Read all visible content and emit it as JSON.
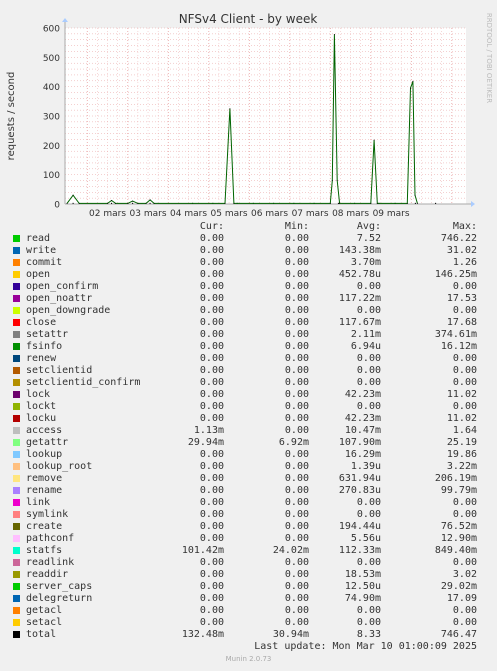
{
  "chart_data": {
    "type": "line",
    "title": "NFSv4 Client - by week",
    "ylabel": "requests / second",
    "ylim": [
      0,
      600
    ],
    "y_ticks": [
      "0",
      "100",
      "200",
      "300",
      "400",
      "500",
      "600"
    ],
    "x_ticks": [
      "02 mars",
      "03 mars",
      "04 mars",
      "05 mars",
      "06 mars",
      "07 mars",
      "08 mars",
      "09 mars"
    ],
    "grid": true,
    "side_label": "RRDTOOL / TOBI OETIKER",
    "series": [
      {
        "name": "total",
        "points": [
          [
            0.5,
            2
          ],
          [
            0.65,
            30
          ],
          [
            0.8,
            2
          ],
          [
            1.5,
            2
          ],
          [
            1.6,
            12
          ],
          [
            1.7,
            2
          ],
          [
            2.0,
            2
          ],
          [
            2.12,
            10
          ],
          [
            2.25,
            2
          ],
          [
            2.45,
            2
          ],
          [
            2.55,
            14
          ],
          [
            2.65,
            2
          ],
          [
            4.4,
            2
          ],
          [
            4.52,
            325
          ],
          [
            4.62,
            2
          ],
          [
            7.0,
            2
          ],
          [
            7.05,
            80
          ],
          [
            7.1,
            578
          ],
          [
            7.17,
            80
          ],
          [
            7.23,
            2
          ],
          [
            8.0,
            2
          ],
          [
            8.08,
            218
          ],
          [
            8.16,
            2
          ],
          [
            8.9,
            2
          ],
          [
            8.98,
            395
          ],
          [
            9.04,
            418
          ],
          [
            9.09,
            30
          ],
          [
            9.15,
            2
          ]
        ]
      }
    ],
    "small_spikes_x": [
      0.65,
      1.6,
      2.12,
      2.55,
      3.6,
      4.1,
      4.7,
      5.1,
      5.6,
      6.1,
      6.6,
      7.2,
      7.6,
      8.2,
      8.6,
      9.1,
      9.6
    ],
    "colors": {
      "line": "#006400",
      "grid": "#e8a0a0",
      "axis": "#aaaaaa",
      "background": "#ffffff"
    }
  },
  "legend": {
    "headers": {
      "cur": "Cur:",
      "min": "Min:",
      "avg": "Avg:",
      "max": "Max:"
    },
    "rows": [
      {
        "name": "read",
        "color": "#00cc00",
        "cur": "0.00",
        "min": "0.00",
        "avg": "7.52",
        "max": "746.22"
      },
      {
        "name": "write",
        "color": "#0066b3",
        "cur": "0.00",
        "min": "0.00",
        "avg": "143.38m",
        "max": "31.02"
      },
      {
        "name": "commit",
        "color": "#ff8000",
        "cur": "0.00",
        "min": "0.00",
        "avg": "3.70m",
        "max": "1.26"
      },
      {
        "name": "open",
        "color": "#ffcc00",
        "cur": "0.00",
        "min": "0.00",
        "avg": "452.78u",
        "max": "146.25m"
      },
      {
        "name": "open_confirm",
        "color": "#330099",
        "cur": "0.00",
        "min": "0.00",
        "avg": "0.00",
        "max": "0.00"
      },
      {
        "name": "open_noattr",
        "color": "#990099",
        "cur": "0.00",
        "min": "0.00",
        "avg": "117.22m",
        "max": "17.53"
      },
      {
        "name": "open_downgrade",
        "color": "#ccff00",
        "cur": "0.00",
        "min": "0.00",
        "avg": "0.00",
        "max": "0.00"
      },
      {
        "name": "close",
        "color": "#ff0000",
        "cur": "0.00",
        "min": "0.00",
        "avg": "117.67m",
        "max": "17.68"
      },
      {
        "name": "setattr",
        "color": "#808080",
        "cur": "0.00",
        "min": "0.00",
        "avg": "2.11m",
        "max": "374.61m"
      },
      {
        "name": "fsinfo",
        "color": "#008f00",
        "cur": "0.00",
        "min": "0.00",
        "avg": "6.94u",
        "max": "16.12m"
      },
      {
        "name": "renew",
        "color": "#00487d",
        "cur": "0.00",
        "min": "0.00",
        "avg": "0.00",
        "max": "0.00"
      },
      {
        "name": "setclientid",
        "color": "#b35a00",
        "cur": "0.00",
        "min": "0.00",
        "avg": "0.00",
        "max": "0.00"
      },
      {
        "name": "setclientid_confirm",
        "color": "#b38f00",
        "cur": "0.00",
        "min": "0.00",
        "avg": "0.00",
        "max": "0.00"
      },
      {
        "name": "lock",
        "color": "#6b006b",
        "cur": "0.00",
        "min": "0.00",
        "avg": "42.23m",
        "max": "11.02"
      },
      {
        "name": "lockt",
        "color": "#8fb300",
        "cur": "0.00",
        "min": "0.00",
        "avg": "0.00",
        "max": "0.00"
      },
      {
        "name": "locku",
        "color": "#b30000",
        "cur": "0.00",
        "min": "0.00",
        "avg": "42.23m",
        "max": "11.02"
      },
      {
        "name": "access",
        "color": "#bebebe",
        "cur": "1.13m",
        "min": "0.00",
        "avg": "10.47m",
        "max": "1.64"
      },
      {
        "name": "getattr",
        "color": "#80ff80",
        "cur": "29.94m",
        "min": "6.92m",
        "avg": "107.90m",
        "max": "25.19"
      },
      {
        "name": "lookup",
        "color": "#80c9ff",
        "cur": "0.00",
        "min": "0.00",
        "avg": "16.29m",
        "max": "19.86"
      },
      {
        "name": "lookup_root",
        "color": "#ffc080",
        "cur": "0.00",
        "min": "0.00",
        "avg": "1.39u",
        "max": "3.22m"
      },
      {
        "name": "remove",
        "color": "#ffe680",
        "cur": "0.00",
        "min": "0.00",
        "avg": "631.94u",
        "max": "206.19m"
      },
      {
        "name": "rename",
        "color": "#aa80ff",
        "cur": "0.00",
        "min": "0.00",
        "avg": "270.83u",
        "max": "99.79m"
      },
      {
        "name": "link",
        "color": "#ee00cc",
        "cur": "0.00",
        "min": "0.00",
        "avg": "0.00",
        "max": "0.00"
      },
      {
        "name": "symlink",
        "color": "#ff8080",
        "cur": "0.00",
        "min": "0.00",
        "avg": "0.00",
        "max": "0.00"
      },
      {
        "name": "create",
        "color": "#666600",
        "cur": "0.00",
        "min": "0.00",
        "avg": "194.44u",
        "max": "76.52m"
      },
      {
        "name": "pathconf",
        "color": "#ffbfff",
        "cur": "0.00",
        "min": "0.00",
        "avg": "5.56u",
        "max": "12.90m"
      },
      {
        "name": "statfs",
        "color": "#00ffcc",
        "cur": "101.42m",
        "min": "24.02m",
        "avg": "112.33m",
        "max": "849.40m"
      },
      {
        "name": "readlink",
        "color": "#cc6699",
        "cur": "0.00",
        "min": "0.00",
        "avg": "0.00",
        "max": "0.00"
      },
      {
        "name": "readdir",
        "color": "#999900",
        "cur": "0.00",
        "min": "0.00",
        "avg": "18.53m",
        "max": "3.02"
      },
      {
        "name": "server_caps",
        "color": "#00cc00",
        "cur": "0.00",
        "min": "0.00",
        "avg": "12.50u",
        "max": "29.02m"
      },
      {
        "name": "delegreturn",
        "color": "#0066b3",
        "cur": "0.00",
        "min": "0.00",
        "avg": "74.90m",
        "max": "17.09"
      },
      {
        "name": "getacl",
        "color": "#ff8000",
        "cur": "0.00",
        "min": "0.00",
        "avg": "0.00",
        "max": "0.00"
      },
      {
        "name": "setacl",
        "color": "#ffcc00",
        "cur": "0.00",
        "min": "0.00",
        "avg": "0.00",
        "max": "0.00"
      },
      {
        "name": "total",
        "color": "#000000",
        "cur": "132.48m",
        "min": "30.94m",
        "avg": "8.33",
        "max": "746.47"
      }
    ]
  },
  "footer": {
    "last_update": "Last update: Mon Mar 10 01:00:09 2025",
    "munin_version": "Munin 2.0.73"
  }
}
